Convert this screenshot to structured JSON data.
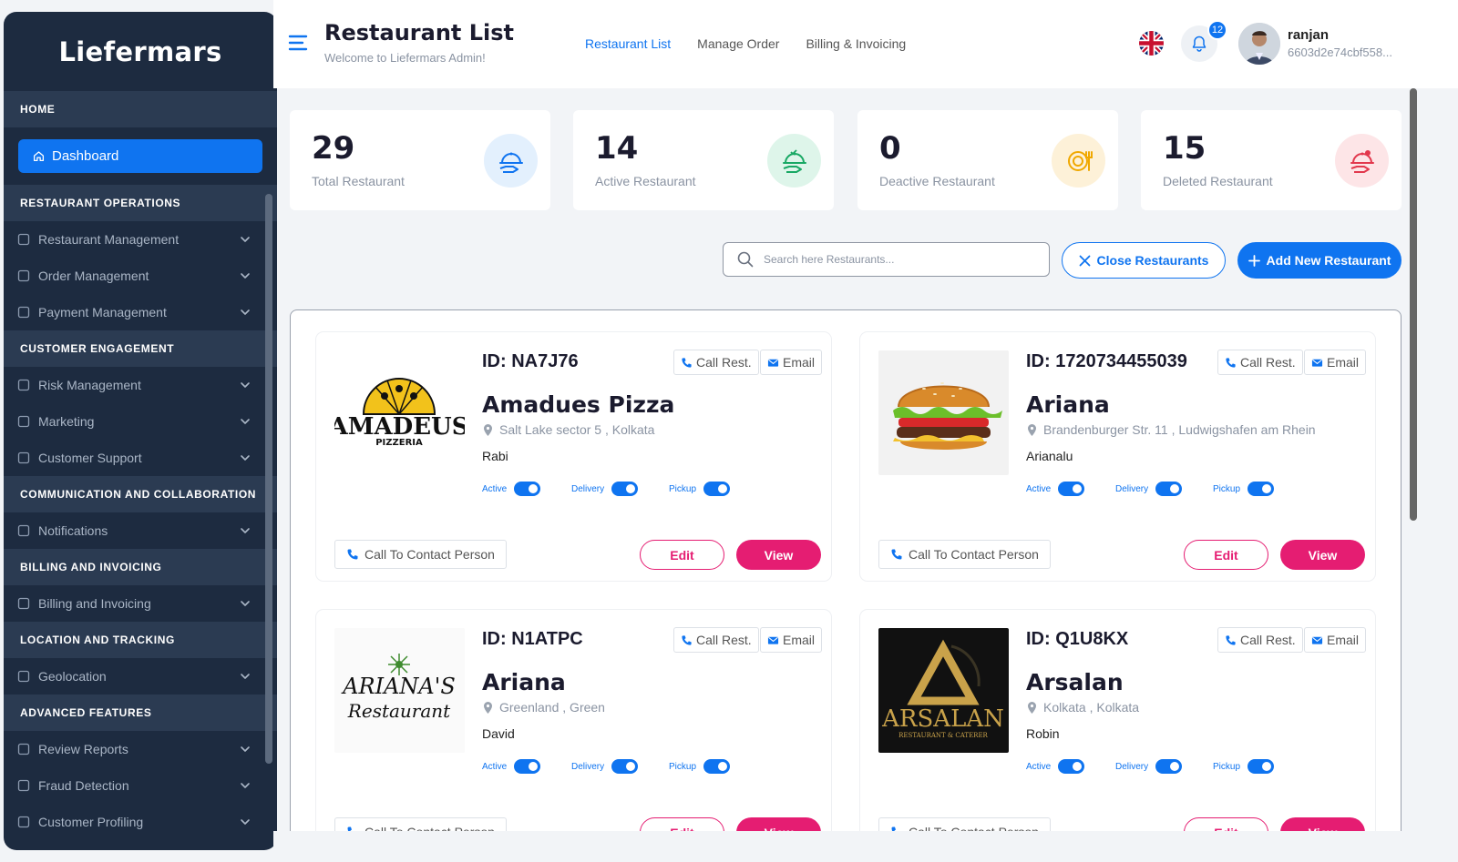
{
  "sidebar": {
    "brand": "Liefermars",
    "home_label": "HOME",
    "dashboard_label": "Dashboard",
    "sections": [
      {
        "title": "RESTAURANT OPERATIONS",
        "items": [
          "Restaurant Management",
          "Order Management",
          "Payment Management"
        ]
      },
      {
        "title": "CUSTOMER ENGAGEMENT",
        "items": [
          "Risk Management",
          "Marketing",
          "Customer Support"
        ]
      },
      {
        "title": "COMMUNICATION AND COLLABORATION",
        "items": [
          "Notifications"
        ]
      },
      {
        "title": "BILLING AND INVOICING",
        "items": [
          "Billing and Invoicing"
        ]
      },
      {
        "title": "LOCATION AND TRACKING",
        "items": [
          "Geolocation"
        ]
      },
      {
        "title": "ADVANCED FEATURES",
        "items": [
          "Review Reports",
          "Fraud Detection",
          "Customer Profiling"
        ]
      }
    ]
  },
  "header": {
    "title": "Restaurant List",
    "subtitle": "Welcome to Liefermars Admin!",
    "nav": [
      "Restaurant List",
      "Manage Order",
      "Billing & Invoicing"
    ],
    "active_nav": "Restaurant List",
    "notification_count": "12",
    "user_name": "ranjan",
    "user_id": "6603d2e74cbf558..."
  },
  "stats": [
    {
      "value": "29",
      "label": "Total Restaurant",
      "color": "#0f74f0",
      "bg": "#e3f0fd",
      "icon": "cloche-icon"
    },
    {
      "value": "14",
      "label": "Active Restaurant",
      "color": "#18a864",
      "bg": "#def5ea",
      "icon": "cloche-check-icon"
    },
    {
      "value": "0",
      "label": "Deactive Restaurant",
      "color": "#f0a800",
      "bg": "#fdf1d8",
      "icon": "plate-cutlery-icon"
    },
    {
      "value": "15",
      "label": "Deleted Restaurant",
      "color": "#e2384d",
      "bg": "#fde5e7",
      "icon": "cloche-x-icon"
    }
  ],
  "actions": {
    "search_placeholder": "Search here Restaurants...",
    "close_label": "Close Restaurants",
    "add_label": "Add New Restaurant"
  },
  "card_labels": {
    "call": "Call Rest.",
    "email": "Email",
    "active": "Active",
    "delivery": "Delivery",
    "pickup": "Pickup",
    "contact": "Call To Contact Person",
    "edit": "Edit",
    "view": "View"
  },
  "restaurants": [
    {
      "id": "ID: NA7J76",
      "name": "Amadues Pizza",
      "address": "Salt Lake sector 5 , Kolkata",
      "owner": "Rabi",
      "logo": "amadeus",
      "logo_text": "AMADEUS",
      "logo_sub": "PIZZERIA",
      "active": true,
      "delivery": true,
      "pickup": true
    },
    {
      "id": "ID: 1720734455039",
      "name": "Ariana",
      "address": "Brandenburger Str. 11 , Ludwigshafen am Rhein",
      "owner": "Arianalu",
      "logo": "burger",
      "logo_text": "",
      "logo_sub": "",
      "active": true,
      "delivery": true,
      "pickup": true
    },
    {
      "id": "ID: N1ATPC",
      "name": "Ariana",
      "address": "Greenland , Green",
      "owner": "David",
      "logo": "ariana",
      "logo_text": "ARIANA'S",
      "logo_sub": "Restaurant",
      "active": true,
      "delivery": true,
      "pickup": true
    },
    {
      "id": "ID: Q1U8KX",
      "name": "Arsalan",
      "address": "Kolkata , Kolkata",
      "owner": "Robin",
      "logo": "arsalan",
      "logo_text": "ARSALAN",
      "logo_sub": "RESTAURANT & CATERER",
      "active": true,
      "delivery": true,
      "pickup": true
    }
  ]
}
